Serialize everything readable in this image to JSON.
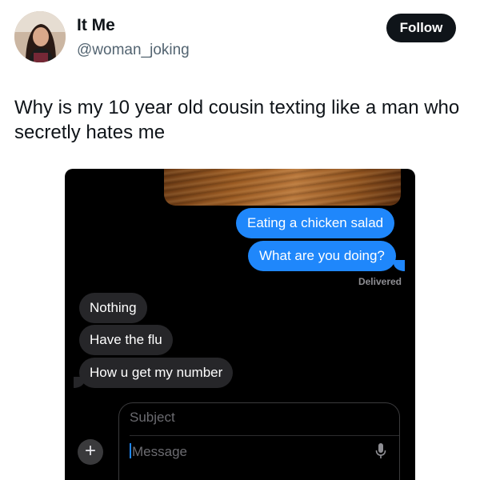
{
  "tweet": {
    "display_name": "It Me",
    "handle": "@woman_joking",
    "follow_label": "Follow",
    "text": "Why is my 10 year old cousin texting like a man who secretly hates me"
  },
  "messages": {
    "sent": [
      "Eating a chicken salad",
      "What are you doing?"
    ],
    "delivered_label": "Delivered",
    "received": [
      "Nothing",
      "Have the flu",
      "How u get my number"
    ],
    "compose": {
      "subject_placeholder": "Subject",
      "message_placeholder": "Message",
      "plus_label": "+"
    }
  },
  "colors": {
    "sent_bubble": "#1f87fb",
    "received_bubble": "#262629",
    "follow_button": "#0f1419"
  },
  "icons": [
    "avatar-photo",
    "plus-icon",
    "microphone-icon"
  ]
}
